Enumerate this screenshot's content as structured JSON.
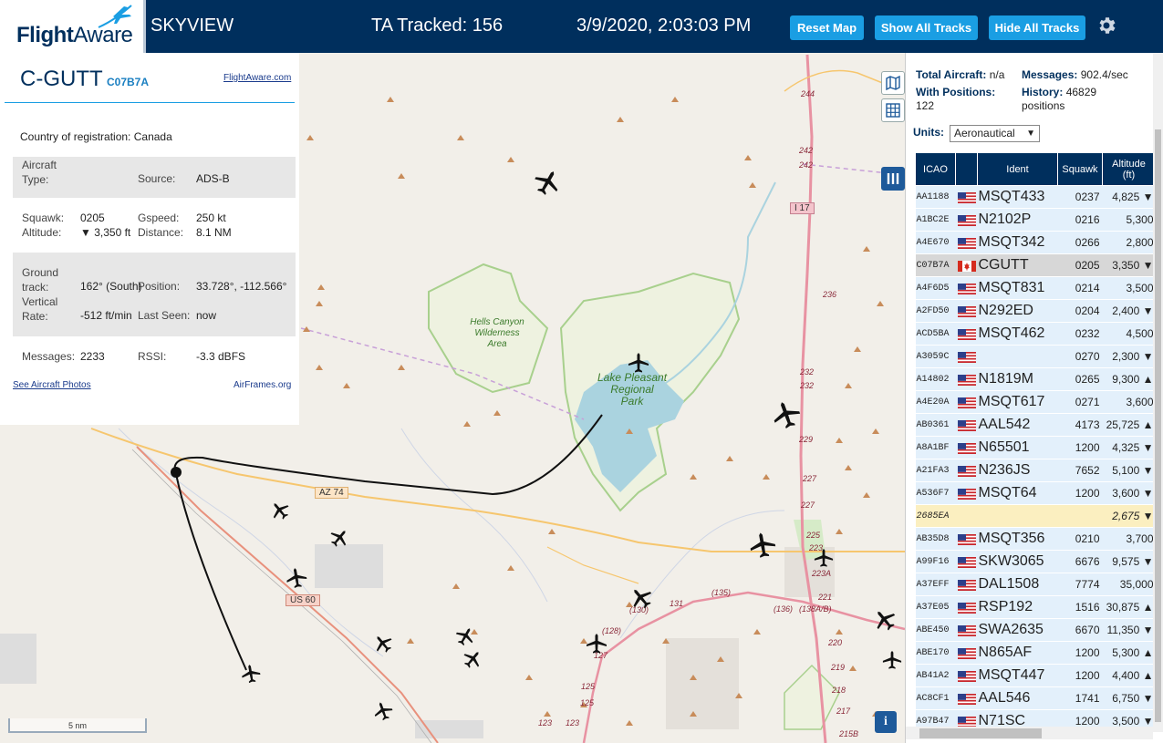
{
  "header": {
    "logo_text_bold": "Flight",
    "logo_text_light": "Aware",
    "app_name": "SKYVIEW",
    "ta_tracked": "TA Tracked: 156",
    "datetime": "3/9/2020, 2:03:03 PM",
    "buttons": {
      "reset_map": "Reset Map",
      "show_all_tracks": "Show All Tracks",
      "hide_all_tracks": "Hide All Tracks"
    },
    "settings_icon": "gear-icon"
  },
  "detail": {
    "ident": "C-GUTT",
    "hex": "C07B7A",
    "flightaware_link": "FlightAware.com",
    "country_label": "Country of registration:",
    "country_value": "Canada",
    "aircraft_type_label": "Aircraft\nType:",
    "aircraft_type_value": "",
    "source_label": "Source:",
    "source_value": "ADS-B",
    "squawk_label": "Squawk:",
    "squawk_value": "0205",
    "altitude_label": "Altitude:",
    "altitude_value": "▼ 3,350 ft",
    "gspeed_label": "Gspeed:",
    "gspeed_value": "250 kt",
    "distance_label": "Distance:",
    "distance_value": "8.1 NM",
    "ground_track_label": "Ground\ntrack:",
    "ground_track_value": "162° (South)",
    "position_label": "Position:",
    "position_value": "33.728°, -112.566°",
    "vertical_rate_label": "Vertical\nRate:",
    "vertical_rate_value": "-512 ft/min",
    "last_seen_label": "Last Seen:",
    "last_seen_value": "now",
    "messages_label": "Messages:",
    "messages_value": "2233",
    "rssi_label": "RSSI:",
    "rssi_value": "-3.3 dBFS",
    "photos_link": "See Aircraft Photos",
    "airframes_link": "AirFrames.org"
  },
  "map": {
    "labels": {
      "hells_canyon": [
        "Hells Canyon",
        "Wilderness",
        "Area"
      ],
      "lake_pleasant": [
        "Lake Pleasant",
        "Regional",
        "Park"
      ],
      "az74": "AZ 74",
      "us60": "US 60",
      "i17": "I 17"
    },
    "road_numbers": [
      "244",
      "242",
      "242",
      "236",
      "232",
      "232",
      "229",
      "227",
      "227",
      "225",
      "223",
      "223A",
      "221",
      "220",
      "219",
      "218",
      "217",
      "215B",
      "(135)",
      "(136)",
      "(138A/B)",
      "(130)",
      "(128)",
      "131",
      "127",
      "125",
      "125",
      "123",
      "123"
    ],
    "scale_label": "5 nm",
    "info_label": "i"
  },
  "sidebar": {
    "total_aircraft_label": "Total Aircraft:",
    "total_aircraft_value": "n/a",
    "messages_label": "Messages:",
    "messages_value": "902.4/sec",
    "with_positions_label": "With Positions:",
    "with_positions_value": "122",
    "history_label": "History:",
    "history_value": "46829",
    "history_unit": "positions",
    "units_label": "Units:",
    "units_value": "Aeronautical",
    "columns": [
      "ICAO",
      "",
      "Ident",
      "Squawk",
      "Altitude\n(ft)"
    ],
    "rows": [
      {
        "icao": "AA1188",
        "flag": "US",
        "ident": "MSQT433",
        "squawk": "0237",
        "alt": "4,825 ▼"
      },
      {
        "icao": "A1BC2E",
        "flag": "US",
        "ident": "N2102P",
        "squawk": "0216",
        "alt": "5,300"
      },
      {
        "icao": "A4E670",
        "flag": "US",
        "ident": "MSQT342",
        "squawk": "0266",
        "alt": "2,800"
      },
      {
        "icao": "C07B7A",
        "flag": "CA",
        "ident": "CGUTT",
        "squawk": "0205",
        "alt": "3,350 ▼",
        "selected": true
      },
      {
        "icao": "A4F6D5",
        "flag": "US",
        "ident": "MSQT831",
        "squawk": "0214",
        "alt": "3,500"
      },
      {
        "icao": "A2FD50",
        "flag": "US",
        "ident": "N292ED",
        "squawk": "0204",
        "alt": "2,400 ▼"
      },
      {
        "icao": "ACD5BA",
        "flag": "US",
        "ident": "MSQT462",
        "squawk": "0232",
        "alt": "4,500"
      },
      {
        "icao": "A3059C",
        "flag": "US",
        "ident": "",
        "squawk": "0270",
        "alt": "2,300 ▼"
      },
      {
        "icao": "A14802",
        "flag": "US",
        "ident": "N1819M",
        "squawk": "0265",
        "alt": "9,300 ▲"
      },
      {
        "icao": "A4E20A",
        "flag": "US",
        "ident": "MSQT617",
        "squawk": "0271",
        "alt": "3,600"
      },
      {
        "icao": "AB0361",
        "flag": "US",
        "ident": "AAL542",
        "squawk": "4173",
        "alt": "25,725 ▲"
      },
      {
        "icao": "A8A1BF",
        "flag": "US",
        "ident": "N65501",
        "squawk": "1200",
        "alt": "4,325 ▼"
      },
      {
        "icao": "A21FA3",
        "flag": "US",
        "ident": "N236JS",
        "squawk": "7652",
        "alt": "5,100 ▼"
      },
      {
        "icao": "A536F7",
        "flag": "US",
        "ident": "MSQT64",
        "squawk": "1200",
        "alt": "3,600 ▼"
      },
      {
        "icao": "2685EA",
        "flag": "",
        "ident": "",
        "squawk": "",
        "alt": "2,675 ▼",
        "highlight": true
      },
      {
        "icao": "AB35D8",
        "flag": "US",
        "ident": "MSQT356",
        "squawk": "0210",
        "alt": "3,700"
      },
      {
        "icao": "A99F16",
        "flag": "US",
        "ident": "SKW3065",
        "squawk": "6676",
        "alt": "9,575 ▼"
      },
      {
        "icao": "A37EFF",
        "flag": "US",
        "ident": "DAL1508",
        "squawk": "7774",
        "alt": "35,000"
      },
      {
        "icao": "A37E05",
        "flag": "US",
        "ident": "RSP192",
        "squawk": "1516",
        "alt": "30,875 ▲"
      },
      {
        "icao": "ABE450",
        "flag": "US",
        "ident": "SWA2635",
        "squawk": "6670",
        "alt": "11,350 ▼"
      },
      {
        "icao": "ABE170",
        "flag": "US",
        "ident": "N865AF",
        "squawk": "1200",
        "alt": "5,300 ▲"
      },
      {
        "icao": "AB41A2",
        "flag": "US",
        "ident": "MSQT447",
        "squawk": "1200",
        "alt": "4,400 ▲"
      },
      {
        "icao": "AC8CF1",
        "flag": "US",
        "ident": "AAL546",
        "squawk": "1741",
        "alt": "6,750 ▼"
      },
      {
        "icao": "A97B47",
        "flag": "US",
        "ident": "N71SC",
        "squawk": "1200",
        "alt": "3,500 ▼"
      }
    ]
  },
  "colors": {
    "header_bg": "#002f5d",
    "accent": "#1a9ee3",
    "table_row": "#e3f0fb",
    "selected_row": "#d7d7d7",
    "highlight_row": "#fbefc0"
  }
}
